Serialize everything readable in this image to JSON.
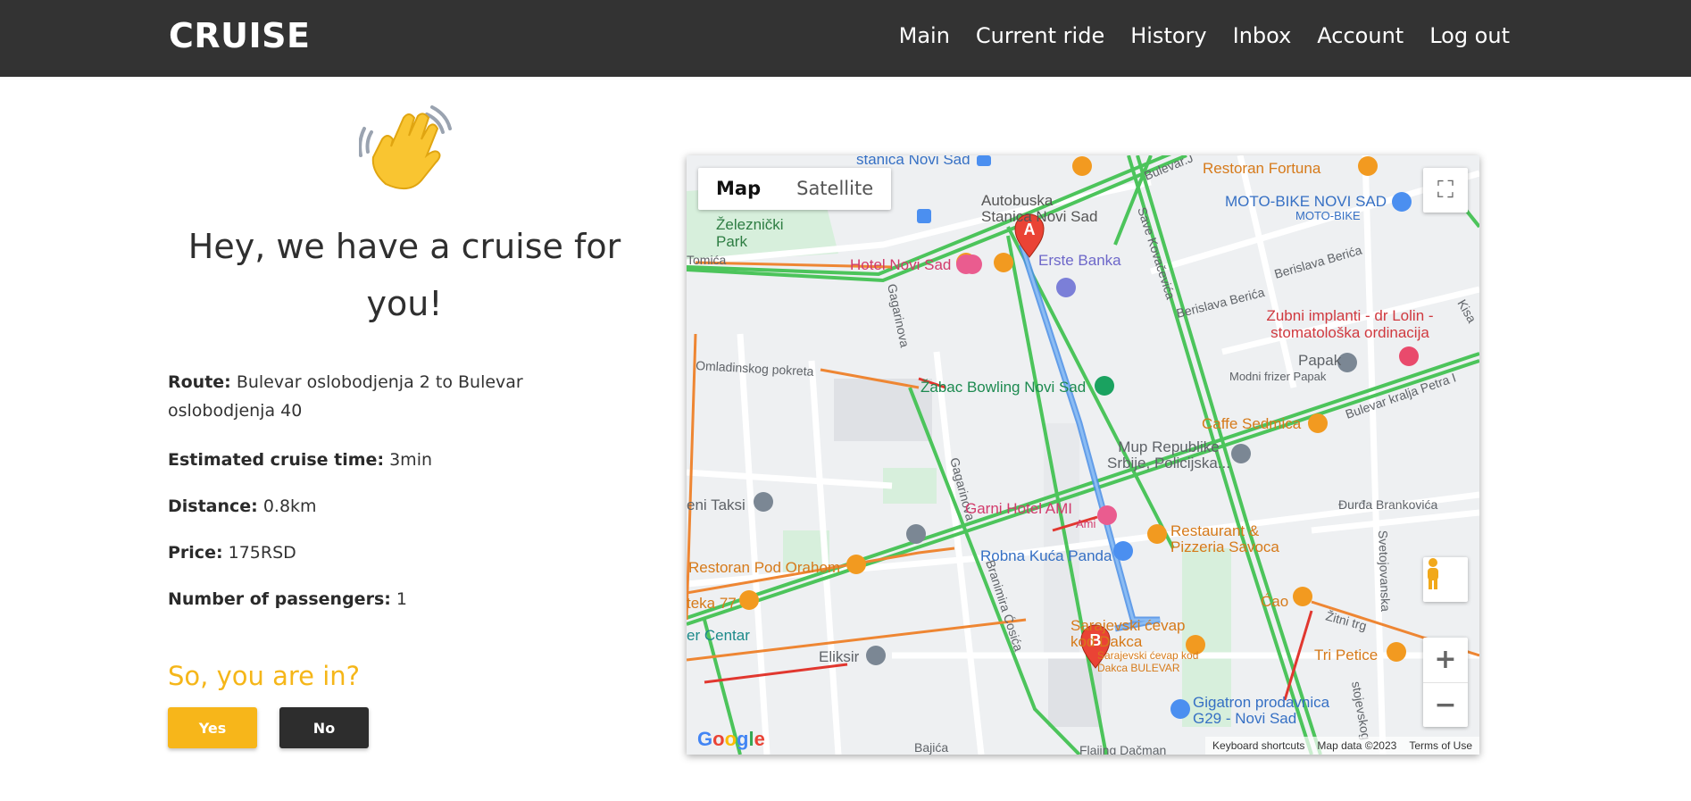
{
  "brand": "CRUISE",
  "nav": [
    "Main",
    "Current ride",
    "History",
    "Inbox",
    "Account",
    "Log out"
  ],
  "hero": {
    "emoji": "waving-hand-icon",
    "title": "Hey, we have a cruise for you!"
  },
  "ride": {
    "route_label": "Route:",
    "route_value": "Bulevar oslobodjenja 2 to Bulevar oslobodjenja 40",
    "time_label": "Estimated cruise time:",
    "time_value": "3min",
    "distance_label": "Distance:",
    "distance_value": "0.8km",
    "price_label": "Price:",
    "price_value": "175RSD",
    "passengers_label": "Number of passengers:",
    "passengers_value": "1"
  },
  "cta": {
    "question": "So, you are in?",
    "yes": "Yes",
    "no": "No"
  },
  "map": {
    "tab_map": "Map",
    "tab_satellite": "Satellite",
    "marker_a": "A",
    "marker_b": "B",
    "logo": "Google",
    "footer_shortcuts": "Keyboard shortcuts",
    "footer_data": "Map data ©2023",
    "footer_terms": "Terms of Use",
    "labels": {
      "station_top": "stanica Novi Sad",
      "bus_station": "Autobuska Stanica Novi Sad",
      "park": "Železnički Park",
      "hotel_ns": "Hotel Novi Sad",
      "erste": "Erste Banka",
      "fortuna": "Restoran Fortuna",
      "motobike": "MOTO-BIKE NOVI SAD",
      "motobike_sub": "MOTO-BIKE",
      "zubni": "Zubni implanti - dr Lolin - stomatološka ordinacija",
      "papak": "Papak",
      "papak_sub": "Modni frizer Papak",
      "zabac": "Žabac Bowling Novi Sad",
      "sedmica": "Caffe Sedmica",
      "mup": "Mup Republike Srbije, Policijska...",
      "taksi": "eni Taksi",
      "garni": "Garni Hotel AMI",
      "ami": "Ami",
      "savoca": "Restaurant & Pizzeria Savoca",
      "panda": "Robna Kuća Panda",
      "orahom": "Restoran Pod Orahom",
      "teka": "teka 77",
      "centar": "er Centar",
      "eliksir": "Eliksir",
      "cevap": "Sarajevski ćevap kod Dakca",
      "cevap_sub": "Sarajevski ćevap kod Dakca BULEVAR",
      "cao": "Ćao",
      "petice": "Tri Petice",
      "gigatron": "Gigatron prodavnica G29 - Novi Sad",
      "st_bulevar": "Bulevar.J",
      "st_omladinskog": "Omladinskog pokreta",
      "st_gagarinova": "Gagarinova",
      "st_gagarinova2": "Gagarinova",
      "st_kovacevica": "Save Kovačevića",
      "st_berica": "Berislava Berića",
      "st_berica2": "Berislava Berića",
      "st_petra": "Bulevar kralja Petra I",
      "st_brankovica": "Đurđa Brankovića",
      "st_svetojovanska": "Svetojovanska",
      "st_zitni": "Žitni trg",
      "st_cosica": "Branimira Ćosića",
      "st_bajica": "Bajića",
      "st_tomica": "Tomića",
      "st_kisa": "Kisa",
      "st_stojevsk": "stojevskog",
      "st_flajing": "Flajing Dačman"
    }
  }
}
